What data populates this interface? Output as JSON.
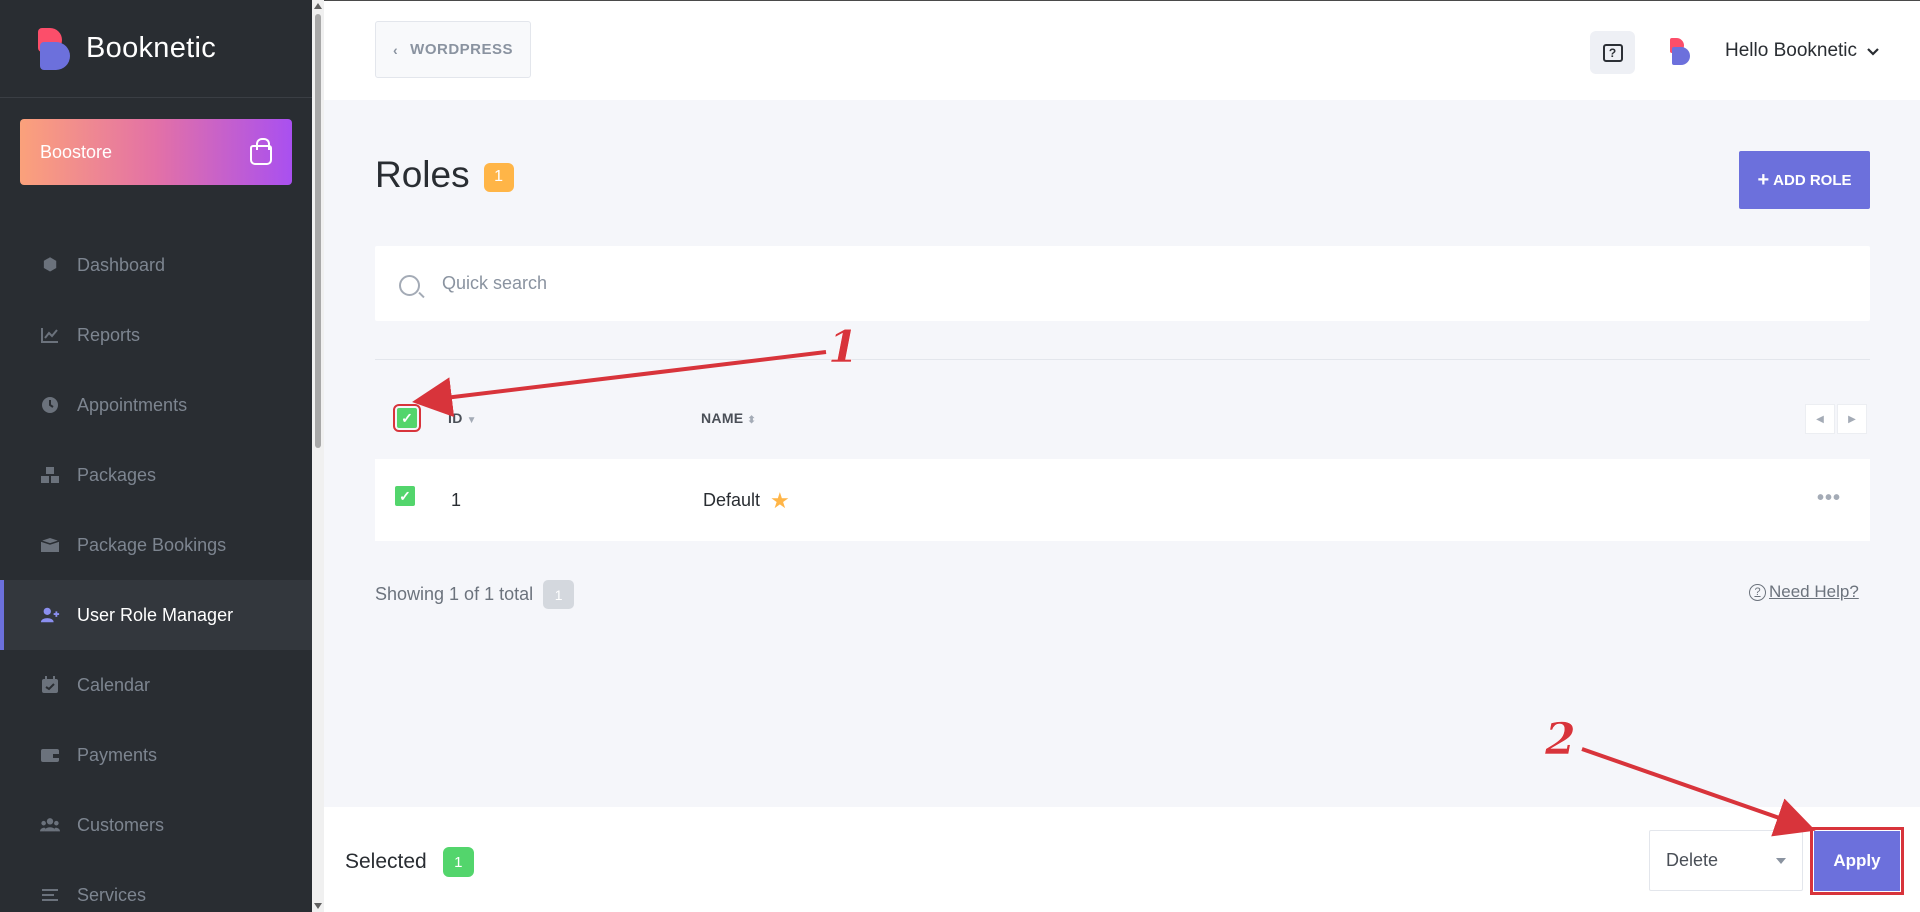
{
  "sidebar": {
    "brand": "Booknetic",
    "boostore_label": "Boostore",
    "items": [
      {
        "label": "Dashboard",
        "icon": "cube-icon",
        "glyph": "⬢"
      },
      {
        "label": "Reports",
        "icon": "chart-line-icon",
        "glyph": "📈"
      },
      {
        "label": "Appointments",
        "icon": "clock-icon",
        "glyph": "🕓"
      },
      {
        "label": "Packages",
        "icon": "cubes-icon",
        "glyph": "⬡"
      },
      {
        "label": "Package Bookings",
        "icon": "box-open-icon",
        "glyph": "▣"
      },
      {
        "label": "User Role Manager",
        "icon": "user-plus-icon",
        "glyph": "👤",
        "active": true
      },
      {
        "label": "Calendar",
        "icon": "calendar-check-icon",
        "glyph": "▦"
      },
      {
        "label": "Payments",
        "icon": "wallet-icon",
        "glyph": "▬"
      },
      {
        "label": "Customers",
        "icon": "users-icon",
        "glyph": "👥"
      },
      {
        "label": "Services",
        "icon": "list-icon",
        "glyph": "≡"
      }
    ]
  },
  "topbar": {
    "back_label": "WORDPRESS",
    "user_greeting": "Hello Booknetic"
  },
  "main": {
    "title": "Roles",
    "count": "1",
    "add_button": "ADD ROLE",
    "search_placeholder": "Quick search",
    "columns": {
      "id": "ID",
      "name": "NAME"
    },
    "rows": [
      {
        "id": "1",
        "name": "Default",
        "checked": true,
        "default": true
      }
    ],
    "showing_text": "Showing 1 of 1 total",
    "total": "1",
    "need_help": "Need Help?"
  },
  "bottom": {
    "selected_label": "Selected",
    "selected_count": "1",
    "bulk_action": "Delete",
    "apply_label": "Apply"
  },
  "annotations": {
    "step1": "1",
    "step2": "2"
  },
  "colors": {
    "accent": "#6c70dc",
    "sidebar_bg": "#292d32",
    "badge_orange": "#ffb547",
    "check_green": "#53d56c",
    "annotation_red": "#d8343b"
  }
}
